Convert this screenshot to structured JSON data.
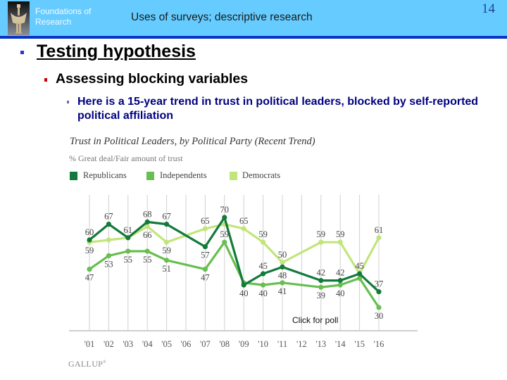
{
  "header": {
    "course_line1": "Foundations of",
    "course_line2": "Research",
    "title": "Uses of surveys; descriptive research",
    "page_number": "14",
    "logo_icon": "figurine-logo-icon"
  },
  "colors": {
    "header_bg": "#66ccff",
    "header_stripe": "#0a33c4",
    "bullet_level1": "#3333cc",
    "bullet_level2": "#cc0000",
    "text_level3": "#000080"
  },
  "content": {
    "level1": "Testing hypothesis",
    "level2": "Assessing blocking variables",
    "level3": "Here is a 15-year trend in trust in political leaders, blocked by self-reported political affiliation"
  },
  "chart_link": "Click for poll",
  "chart_data": {
    "type": "line",
    "title": "Trust in Political Leaders, by Political Party (Recent Trend)",
    "subtitle": "% Great deal/Fair amount of trust",
    "xlabel": "",
    "ylabel": "",
    "x": [
      "'01",
      "'02",
      "'03",
      "'04",
      "'05",
      "'06",
      "'07",
      "'08",
      "'09",
      "'10",
      "'11",
      "'12",
      "'13",
      "'14",
      "'15",
      "'16"
    ],
    "ylim": [
      20,
      80
    ],
    "grid": "vertical",
    "legend_position": "top-left",
    "series": [
      {
        "name": "Republicans",
        "color": "#127a3a",
        "values": [
          60,
          67,
          61,
          68,
          67,
          null,
          57,
          70,
          40,
          45,
          48,
          null,
          42,
          42,
          45,
          37
        ],
        "labels": [
          "60",
          "67",
          "61",
          "68",
          "67",
          null,
          "57",
          "70",
          "40",
          "45",
          "48",
          null,
          "42",
          "42",
          "45",
          "37"
        ]
      },
      {
        "name": "Independents",
        "color": "#66bf4f",
        "values": [
          47,
          53,
          55,
          55,
          51,
          null,
          47,
          59,
          41,
          40,
          41,
          null,
          39,
          40,
          43,
          30
        ],
        "labels": [
          "47",
          "53",
          "55",
          "55",
          "51",
          null,
          "47",
          "59",
          null,
          "40",
          "41",
          null,
          "39",
          "40",
          null,
          "30"
        ]
      },
      {
        "name": "Democrats",
        "color": "#c2e57a",
        "values": [
          59,
          60,
          61,
          66,
          59,
          null,
          65,
          67,
          65,
          59,
          50,
          null,
          59,
          59,
          45,
          61
        ],
        "labels": [
          "59",
          null,
          null,
          "66",
          "59",
          null,
          "65",
          null,
          "65",
          "59",
          "50",
          null,
          "59",
          "59",
          null,
          "61"
        ]
      }
    ],
    "source": "GALLUP",
    "source_mark": "®"
  }
}
